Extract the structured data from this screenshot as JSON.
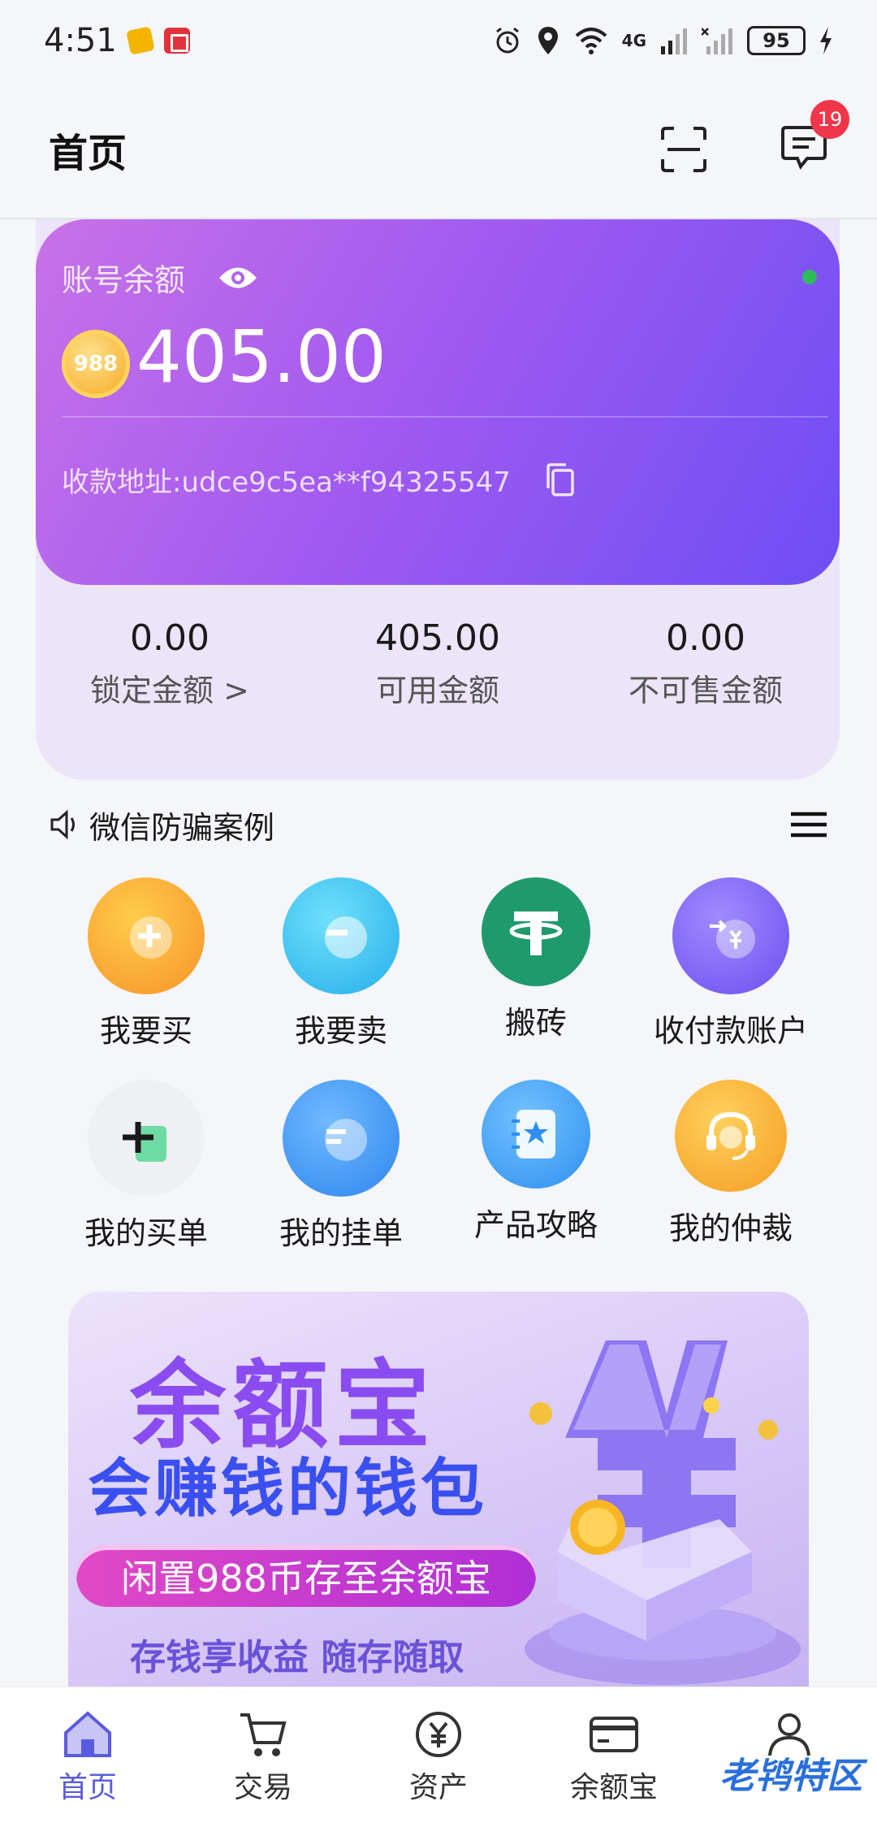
{
  "status_bar": {
    "time": "4:51",
    "battery": "95",
    "network": "4G"
  },
  "header": {
    "title": "首页",
    "message_badge": "19"
  },
  "balance": {
    "label": "账号余额",
    "coin_text": "988",
    "amount": "405.00",
    "address": "收款地址:udce9c5ea**f94325547"
  },
  "stats": [
    {
      "value": "0.00",
      "label": "锁定金额 >"
    },
    {
      "value": "405.00",
      "label": "可用金额"
    },
    {
      "value": "0.00",
      "label": "不可售金额"
    }
  ],
  "notice": {
    "text": "微信防骗案例"
  },
  "grid": [
    {
      "label": "我要买",
      "icon": "plus-buy-icon",
      "color": "#f8a62b"
    },
    {
      "label": "我要卖",
      "icon": "minus-sell-icon",
      "color": "#3fc6f2"
    },
    {
      "label": "搬砖",
      "icon": "tether-icon",
      "color": "#1f9a6c"
    },
    {
      "label": "收付款账户",
      "icon": "transfer-yen-icon",
      "color": "#7b5ff0"
    },
    {
      "label": "我的买单",
      "icon": "buy-order-icon",
      "color": "#f2f3f5"
    },
    {
      "label": "我的挂单",
      "icon": "pending-order-icon",
      "color": "#3c9af2"
    },
    {
      "label": "产品攻略",
      "icon": "guide-book-icon",
      "color": "#3a9cf2"
    },
    {
      "label": "我的仲裁",
      "icon": "headset-icon",
      "color": "#f7a92c"
    }
  ],
  "banner": {
    "title": "余额宝",
    "subtitle": "会赚钱的钱包",
    "pill": "闲置988币存至余额宝",
    "footer": "存钱享收益 随存随取"
  },
  "tabs": [
    {
      "label": "首页",
      "icon": "home-icon",
      "active": true
    },
    {
      "label": "交易",
      "icon": "cart-icon",
      "active": false
    },
    {
      "label": "资产",
      "icon": "yen-coin-icon",
      "active": false
    },
    {
      "label": "余额宝",
      "icon": "card-icon",
      "active": false
    },
    {
      "label": "我的",
      "icon": "user-icon",
      "active": false
    }
  ],
  "watermark": "老鸨特区"
}
